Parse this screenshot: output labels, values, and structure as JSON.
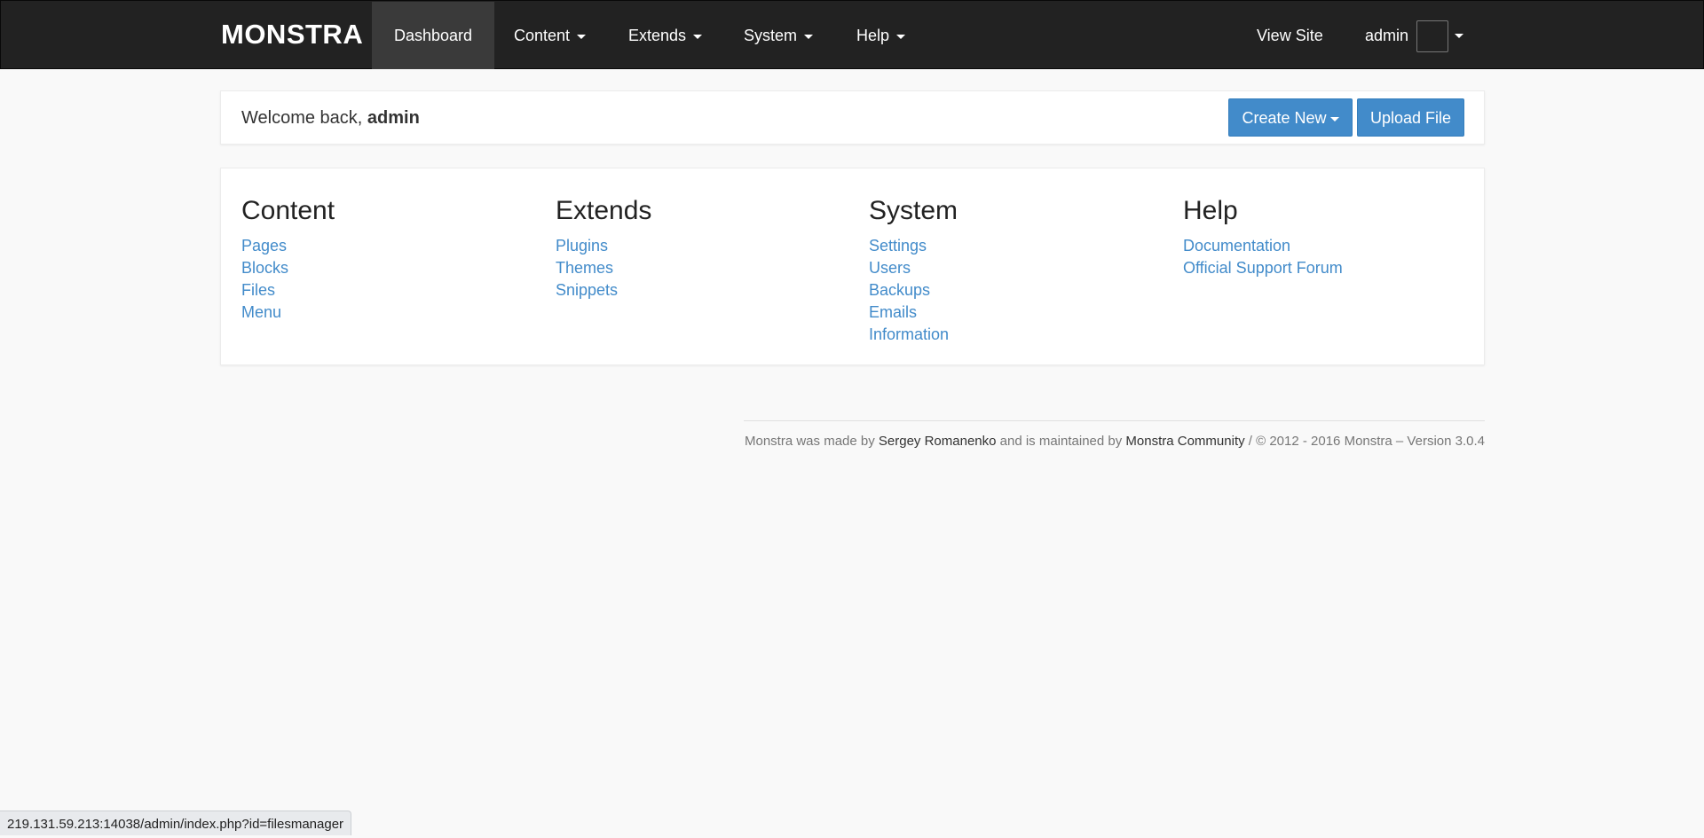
{
  "navbar": {
    "brand": "MONSTRA",
    "items": [
      {
        "label": "Dashboard"
      },
      {
        "label": "Content"
      },
      {
        "label": "Extends"
      },
      {
        "label": "System"
      },
      {
        "label": "Help"
      }
    ],
    "view_site": "View Site",
    "user": "admin"
  },
  "welcome": {
    "prefix": "Welcome back, ",
    "user": "admin",
    "create_new": "Create New",
    "upload_file": "Upload File"
  },
  "sections": [
    {
      "title": "Content",
      "links": [
        "Pages",
        "Blocks",
        "Files",
        "Menu"
      ]
    },
    {
      "title": "Extends",
      "links": [
        "Plugins",
        "Themes",
        "Snippets"
      ]
    },
    {
      "title": "System",
      "links": [
        "Settings",
        "Users",
        "Backups",
        "Emails",
        "Information"
      ]
    },
    {
      "title": "Help",
      "links": [
        "Documentation",
        "Official Support Forum"
      ]
    }
  ],
  "footer": {
    "text1": "Monstra was made by ",
    "author": "Sergey Romanenko",
    "text2": " and is maintained by ",
    "community": "Monstra Community",
    "text3": " / © 2012 - 2016 Monstra – Version 3.0.4"
  },
  "statusbar": {
    "url": "219.131.59.213:14038/admin/index.php?id=filesmanager"
  },
  "colors": {
    "navbar_bg": "#222222",
    "accent": "#428bca",
    "page_bg": "#f9f9f9"
  }
}
